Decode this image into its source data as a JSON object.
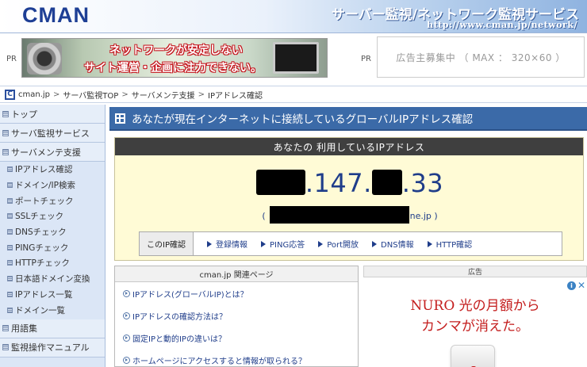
{
  "header": {
    "logo": "CMAN",
    "tagline": "サーバー監視/ネットワーク監視サービス",
    "url": "http://www.cman.jp/network/"
  },
  "adstrip": {
    "pr_left": "PR",
    "pr_right": "PR",
    "banner_line1": "ネットワークが安定しない",
    "banner_line2": "サイト運営・企画に注力できない。",
    "adspace_text": "広告主募集中 （ MAX ： 320×60 ）"
  },
  "breadcrumb": {
    "icon": "C",
    "items": [
      "cman.jp",
      "サーバ監視TOP",
      "サーバメンテ支援",
      "IPアドレス確認"
    ],
    "separator": ">"
  },
  "sidebar": {
    "items": [
      {
        "label": "トップ"
      },
      {
        "label": "サーバ監視サービス"
      },
      {
        "label": "サーバメンテ支援"
      },
      {
        "label": "IPアドレス確認"
      },
      {
        "label": "ドメイン/IP検索"
      },
      {
        "label": "ポートチェック"
      },
      {
        "label": "SSLチェック"
      },
      {
        "label": "DNSチェック"
      },
      {
        "label": "PINGチェック"
      },
      {
        "label": "HTTPチェック"
      },
      {
        "label": "日本語ドメイン変換"
      },
      {
        "label": "IPアドレス一覧"
      },
      {
        "label": "ドメイン一覧"
      },
      {
        "label": "用語集"
      },
      {
        "label": "監視操作マニュアル"
      }
    ]
  },
  "main": {
    "page_title": "あなたが現在インターネットに接続しているグローバルIPアドレス確認",
    "ipbox": {
      "header": "あなたの 利用しているIPアドレス",
      "ip_mid": ".147.",
      "ip_end": ".33",
      "host_open": "(",
      "host_suffix": "ne.jp",
      "host_close": ")"
    },
    "checkbar": {
      "title": "このIP確認",
      "links": [
        "登録情報",
        "PING応答",
        "Port開放",
        "DNS情報",
        "HTTP確認"
      ]
    },
    "related": {
      "header": "cman.jp 関連ページ",
      "links": [
        "IPアドレス(グローバルIP)とは？",
        "IPアドレスの確認方法は？",
        "固定IPと動的IPの違いは？",
        "ホームページにアクセスすると情報が取られる？"
      ]
    },
    "ad": {
      "header": "広告",
      "line1": "NURO 光の月額から",
      "line2": "カンマが消えた。",
      "info_icon": "i",
      "close_icon": "✕"
    }
  },
  "colors": {
    "title_bar": "#3b6aa8",
    "sidebar_bg": "#dbe6f6",
    "ip_box_bg": "#fffbd6",
    "ip_text": "#1f3d8a",
    "ad_text": "#c41e1e"
  }
}
